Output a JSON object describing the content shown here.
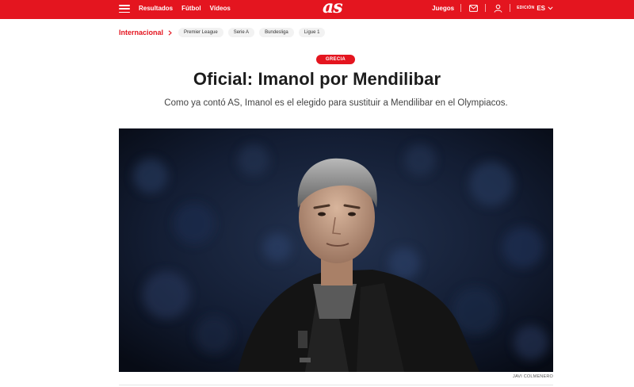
{
  "header": {
    "nav": [
      "Resultados",
      "Fútbol",
      "Vídeos"
    ],
    "logo": "as",
    "juegos": "Juegos",
    "edicion_label": "EDICIÓN",
    "edicion_value": "ES",
    "brand_color": "#e4151f"
  },
  "section_nav": {
    "current": "Internacional",
    "chips": [
      "Premier League",
      "Serie A",
      "Bundesliga",
      "Ligue 1"
    ]
  },
  "article": {
    "tag": "GRECIA",
    "title": "Oficial: Imanol por Mendilibar",
    "subtitle": "Como ya contó AS, Imanol es el elegido para sustituir a Mendilibar en el Olympiacos.",
    "photo_credit": "JAVI COLMENERO"
  }
}
